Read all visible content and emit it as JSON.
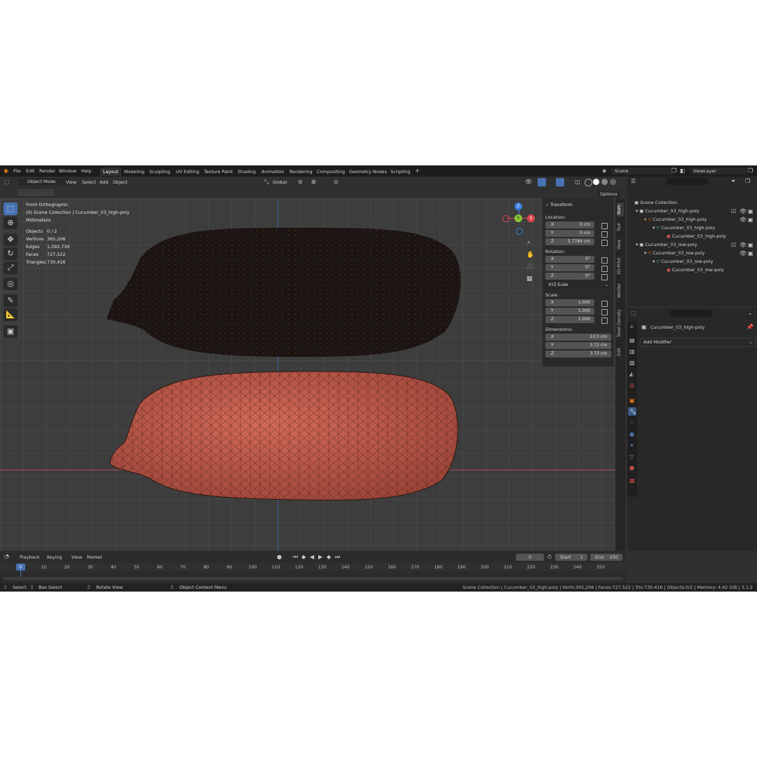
{
  "menubar": {
    "items": [
      "File",
      "Edit",
      "Render",
      "Window",
      "Help"
    ],
    "workspaces": [
      "Layout",
      "Modeling",
      "Sculpting",
      "UV Editing",
      "Texture Paint",
      "Shading",
      "Animation",
      "Rendering",
      "Compositing",
      "Geometry Nodes",
      "Scripting"
    ],
    "add_tab": "+",
    "scene": "Scene",
    "view_layer": "ViewLayer"
  },
  "header": {
    "mode": "Object Mode",
    "menus": [
      "View",
      "Select",
      "Add",
      "Object"
    ],
    "orientation": "Global",
    "options": "Options"
  },
  "overlay": {
    "view_name": "Front Orthographic",
    "collection": "(0) Scene Collection | Cucumber_03_high-poly",
    "units": "Millimeters",
    "stats": [
      {
        "label": "Objects",
        "value": "0 / 2"
      },
      {
        "label": "Vertices",
        "value": "365,206"
      },
      {
        "label": "Edges",
        "value": "1,092,730"
      },
      {
        "label": "Faces",
        "value": "727,522"
      },
      {
        "label": "Triangles",
        "value": "730,416"
      }
    ]
  },
  "gizmo": {
    "z": "Z",
    "y": "Y",
    "x": "X"
  },
  "transform": {
    "title": "Transform",
    "location_label": "Location:",
    "location": [
      {
        "axis": "X",
        "value": "0 cm"
      },
      {
        "axis": "Y",
        "value": "0 cm"
      },
      {
        "axis": "Z",
        "value": "5.7784 cm"
      }
    ],
    "rotation_label": "Rotation:",
    "rotation": [
      {
        "axis": "X",
        "value": "0°"
      },
      {
        "axis": "Y",
        "value": "0°"
      },
      {
        "axis": "Z",
        "value": "0°"
      }
    ],
    "rotation_mode": "XYZ Euler",
    "scale_label": "Scale:",
    "scale": [
      {
        "axis": "X",
        "value": "1.000"
      },
      {
        "axis": "Y",
        "value": "1.000"
      },
      {
        "axis": "Z",
        "value": "1.000"
      }
    ],
    "dimensions_label": "Dimensions:",
    "dimensions": [
      {
        "axis": "X",
        "value": "10.5 cm"
      },
      {
        "axis": "Y",
        "value": "3.72 cm"
      },
      {
        "axis": "Z",
        "value": "3.73 cm"
      }
    ]
  },
  "side_tabs": [
    "Item",
    "Tool",
    "View",
    "3D-Print",
    "Welder",
    "Texel Density",
    "Edit"
  ],
  "outliner": {
    "root": "Scene Collection",
    "items": [
      "Cucumber_03_high-poly",
      "Cucumber_03_high-poly",
      "Cucumber_03_high-poly",
      "Cucumber_03_high-poly",
      "Cucumber_03_low-poly",
      "Cucumber_03_low-poly",
      "Cucumber_03_low-poly",
      "Cucumber_03_low-poly"
    ]
  },
  "properties": {
    "object_name": "Cucumber_03_high-poly",
    "add_modifier": "Add Modifier"
  },
  "timeline": {
    "menus": [
      "Playback",
      "Keying",
      "View",
      "Marker"
    ],
    "current_frame": "0",
    "start_label": "Start",
    "start": "1",
    "end_label": "End",
    "end": "250",
    "ticks": [
      "0",
      "10",
      "20",
      "30",
      "40",
      "50",
      "60",
      "70",
      "80",
      "90",
      "100",
      "110",
      "120",
      "130",
      "140",
      "150",
      "160",
      "170",
      "180",
      "190",
      "200",
      "210",
      "220",
      "230",
      "240",
      "250"
    ]
  },
  "statusbar": {
    "select": "Select",
    "box_select": "Box Select",
    "rotate_view": "Rotate View",
    "context_menu": "Object Context Menu",
    "info": "Scene Collection | Cucumber_03_high-poly | Verts:365,206 | Faces:727,522 | Tris:730,416 | Objects:0/2 | Memory: 4.42 GiB | 3.1.2"
  },
  "colors": {
    "accent": "#4772b3",
    "mesh_low_poly": "#c05a4b",
    "mesh_high_poly": "#1a1412",
    "x_axis": "#e0454f",
    "y_axis": "#8bc33a",
    "z_axis": "#3a7fe0"
  }
}
